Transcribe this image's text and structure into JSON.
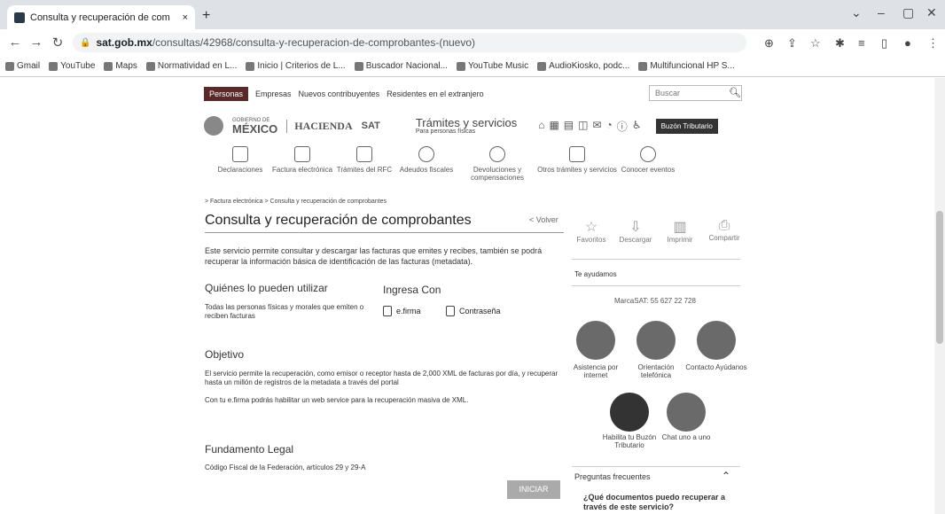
{
  "browser": {
    "tab_title": "Consulta y recuperación de com",
    "tab_close": "×",
    "new_tab": "+",
    "url_domain": "sat.gob.mx",
    "url_path": "/consultas/42968/consulta-y-recuperacion-de-comprobantes-(nuevo)",
    "bookmarks": [
      "Gmail",
      "YouTube",
      "Maps",
      "Normatividad en L...",
      "Inicio | Criterios de L...",
      "Buscador Nacional...",
      "YouTube Music",
      "AudioKiosko, podc...",
      "Multifuncional HP S..."
    ]
  },
  "site": {
    "topnav": [
      "Personas",
      "Empresas",
      "Nuevos contribuyentes",
      "Residentes en el extranjero"
    ],
    "search_placeholder": "Buscar",
    "gobierno": "GOBIERNO DE",
    "mexico": "MÉXICO",
    "hacienda": "HACIENDA",
    "sat": "SAT",
    "tramites_title": "Trámites y servicios",
    "tramites_sub": "Para personas físicas",
    "buzon_btn": "Buzón Tributario",
    "mainnav": [
      {
        "label": "Declaraciones",
        "icon": "declaraciones-icon"
      },
      {
        "label": "Factura electrónica",
        "icon": "factura-icon"
      },
      {
        "label": "Trámites del RFC",
        "icon": "rfc-icon"
      },
      {
        "label": "Adeudos fiscales",
        "icon": "adeudos-icon"
      },
      {
        "label": "Devoluciones y compensaciones",
        "icon": "devoluciones-icon"
      },
      {
        "label": "Otros trámites y servicios",
        "icon": "otros-icon"
      },
      {
        "label": "Conocer eventos",
        "icon": "conocer-icon"
      }
    ]
  },
  "main": {
    "breadcrumb": "> Factura electrónica > Consulta y recuperación de comprobantes",
    "title": "Consulta y recuperación de comprobantes",
    "volver": "< Volver",
    "intro": "Este servicio permite consultar y descargar las facturas que emites y recibes, también se podrá recuperar la información básica de identificación de las facturas (metadata).",
    "quienes_title": "Quiénes lo pueden utilizar",
    "quienes_text": "Todas las personas físicas y morales que emiten o reciben facturas",
    "ingresa_title": "Ingresa Con",
    "efirma": "e.firma",
    "contrasena": "Contraseña",
    "objetivo_title": "Objetivo",
    "objetivo_text": "El servicio permite la recuperación, como emisor o receptor hasta de 2,000 XML de facturas por día, y recuperar hasta un millón de registros de la metadata a través del portal",
    "objetivo_text2": "Con tu e.firma podrás habilitar un web service para la recuperación masiva de XML.",
    "fundamento_title": "Fundamento Legal",
    "fundamento_text": "Código Fiscal de la Federación, artículos 29 y 29-A",
    "iniciar": "INICIAR"
  },
  "side": {
    "actions": [
      "Favoritos",
      "Descargar",
      "Imprimir",
      "Compartir"
    ],
    "te_ayudamos": "Te ayudamos",
    "marcasat": "MarcaSAT: 55 627 22 728",
    "help": [
      {
        "label": "Asistencia por internet"
      },
      {
        "label": "Orientación telefónica"
      },
      {
        "label": "Contacto Ayúdanos"
      },
      {
        "label": "Habilita tu Buzón Tributario"
      },
      {
        "label": "Chat uno a uno"
      }
    ],
    "faq_title": "Preguntas frecuentes",
    "faq_q": "¿Qué documentos puedo recuperar a través de este servicio?"
  }
}
